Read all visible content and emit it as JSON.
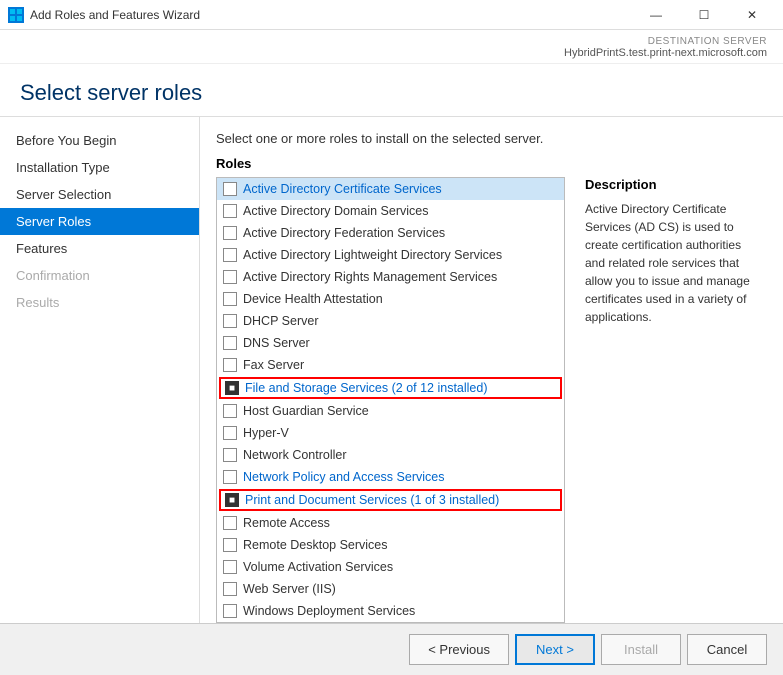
{
  "titlebar": {
    "icon": "⚙",
    "title": "Add Roles and Features Wizard",
    "minimize": "—",
    "maximize": "☐",
    "close": "✕"
  },
  "destination_server": {
    "label": "DESTINATION SERVER",
    "value": "HybridPrintS.test.print-next.microsoft.com"
  },
  "header": {
    "title": "Select server roles"
  },
  "instruction": "Select one or more roles to install on the selected server.",
  "roles_label": "Roles",
  "sidebar": {
    "items": [
      {
        "id": "before-you-begin",
        "label": "Before You Begin",
        "state": "normal"
      },
      {
        "id": "installation-type",
        "label": "Installation Type",
        "state": "normal"
      },
      {
        "id": "server-selection",
        "label": "Server Selection",
        "state": "normal"
      },
      {
        "id": "server-roles",
        "label": "Server Roles",
        "state": "active"
      },
      {
        "id": "features",
        "label": "Features",
        "state": "normal"
      },
      {
        "id": "confirmation",
        "label": "Confirmation",
        "state": "disabled"
      },
      {
        "id": "results",
        "label": "Results",
        "state": "disabled"
      }
    ]
  },
  "roles": [
    {
      "id": "ad-cert",
      "label": "Active Directory Certificate Services",
      "checked": false,
      "highlighted": true,
      "box": false
    },
    {
      "id": "ad-domain",
      "label": "Active Directory Domain Services",
      "checked": false,
      "highlighted": false,
      "box": false
    },
    {
      "id": "ad-fed",
      "label": "Active Directory Federation Services",
      "checked": false,
      "highlighted": false,
      "box": false
    },
    {
      "id": "ad-lightweight",
      "label": "Active Directory Lightweight Directory Services",
      "checked": false,
      "highlighted": false,
      "box": false
    },
    {
      "id": "ad-rights",
      "label": "Active Directory Rights Management Services",
      "checked": false,
      "highlighted": false,
      "box": false
    },
    {
      "id": "device-health",
      "label": "Device Health Attestation",
      "checked": false,
      "highlighted": false,
      "box": false
    },
    {
      "id": "dhcp",
      "label": "DHCP Server",
      "checked": false,
      "highlighted": false,
      "box": false
    },
    {
      "id": "dns",
      "label": "DNS Server",
      "checked": false,
      "highlighted": false,
      "box": false
    },
    {
      "id": "fax",
      "label": "Fax Server",
      "checked": false,
      "highlighted": false,
      "box": false
    },
    {
      "id": "file-storage",
      "label": "File and Storage Services (2 of 12 installed)",
      "checked": true,
      "highlighted": false,
      "box": true
    },
    {
      "id": "host-guardian",
      "label": "Host Guardian Service",
      "checked": false,
      "highlighted": false,
      "box": false
    },
    {
      "id": "hyper-v",
      "label": "Hyper-V",
      "checked": false,
      "highlighted": false,
      "box": false
    },
    {
      "id": "network-controller",
      "label": "Network Controller",
      "checked": false,
      "highlighted": false,
      "box": false
    },
    {
      "id": "network-policy",
      "label": "Network Policy and Access Services",
      "checked": false,
      "highlighted": true,
      "box": false
    },
    {
      "id": "print-doc",
      "label": "Print and Document Services (1 of 3 installed)",
      "checked": true,
      "highlighted": false,
      "box": true
    },
    {
      "id": "remote-access",
      "label": "Remote Access",
      "checked": false,
      "highlighted": false,
      "box": false
    },
    {
      "id": "remote-desktop",
      "label": "Remote Desktop Services",
      "checked": false,
      "highlighted": false,
      "box": false
    },
    {
      "id": "volume-activation",
      "label": "Volume Activation Services",
      "checked": false,
      "highlighted": false,
      "box": false
    },
    {
      "id": "web-server",
      "label": "Web Server (IIS)",
      "checked": false,
      "highlighted": false,
      "box": false
    },
    {
      "id": "windows-deployment",
      "label": "Windows Deployment Services",
      "checked": false,
      "highlighted": false,
      "box": false
    }
  ],
  "description": {
    "title": "Description",
    "text": "Active Directory Certificate Services (AD CS) is used to create certification authorities and related role services that allow you to issue and manage certificates used in a variety of applications."
  },
  "footer": {
    "previous_label": "< Previous",
    "next_label": "Next >",
    "install_label": "Install",
    "cancel_label": "Cancel"
  }
}
